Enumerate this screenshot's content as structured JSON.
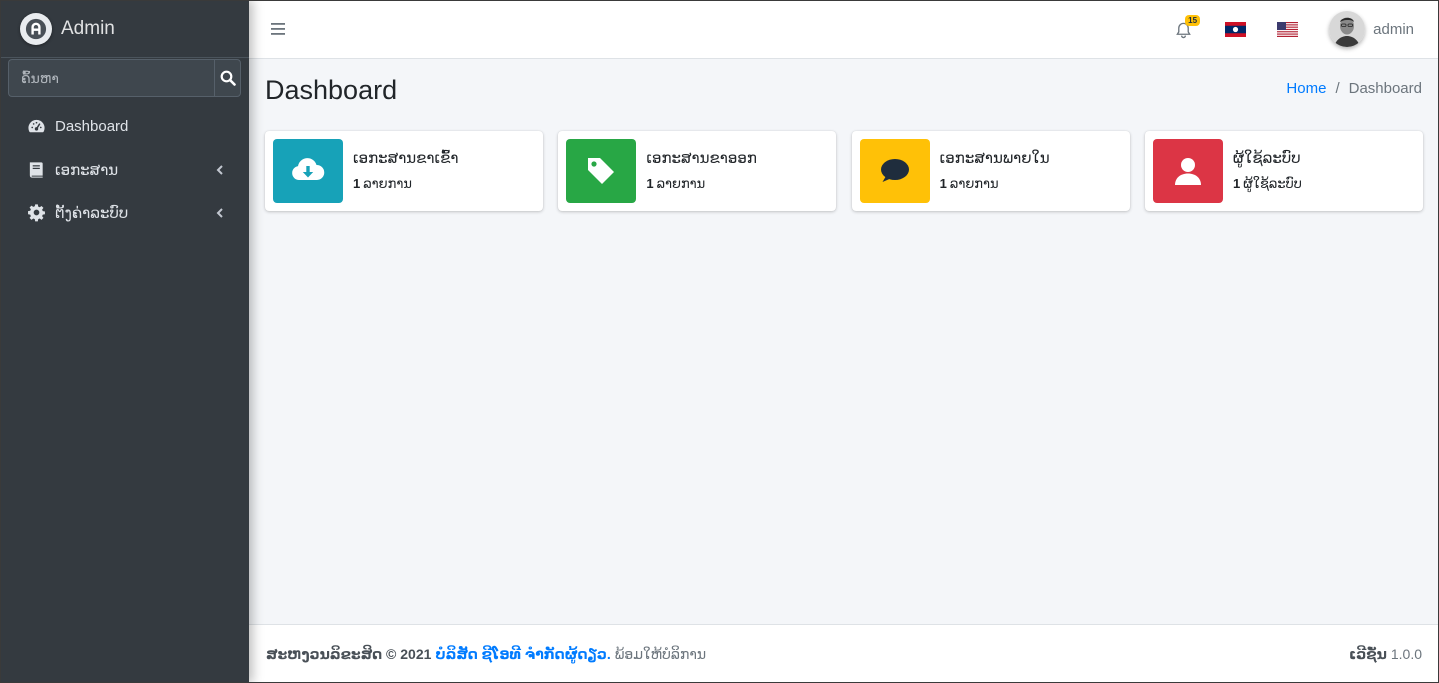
{
  "brand": {
    "name": "Admin"
  },
  "sidebar": {
    "search_placeholder": "ຄົ້ນຫາ",
    "items": [
      {
        "label": "Dashboard",
        "icon": "tachometer-icon",
        "has_children": false
      },
      {
        "label": "ເອກະສານ",
        "icon": "book-icon",
        "has_children": true
      },
      {
        "label": "ຕັ້ງຄ່າລະບົບ",
        "icon": "gear-icon",
        "has_children": true
      }
    ]
  },
  "topbar": {
    "notification_count": "15",
    "user_name": "admin"
  },
  "page": {
    "title": "Dashboard",
    "breadcrumb": {
      "home": "Home",
      "current": "Dashboard"
    }
  },
  "cards": [
    {
      "title": "ເອກະສານຂາເຂົ້າ",
      "count": "1",
      "unit": "ລາຍການ",
      "color": "#17a2b8",
      "icon": "cloud-download-icon"
    },
    {
      "title": "ເອກະສານຂາອອກ",
      "count": "1",
      "unit": "ລາຍການ",
      "color": "#28a745",
      "icon": "tag-icon"
    },
    {
      "title": "ເອກະສານພາຍໃນ",
      "count": "1",
      "unit": "ລາຍການ",
      "color": "#ffc107",
      "icon": "comment-icon"
    },
    {
      "title": "ຜູ້ໃຊ້ລະບົບ",
      "count": "1",
      "unit": "ຜູ້ໃຊ້ລະບົບ",
      "color": "#dc3545",
      "icon": "user-icon"
    }
  ],
  "footer": {
    "copyright_label": "ສະຫງວນລິຂະສິດ © 2021",
    "company": "ບໍລິສັດ ຊີໂອທີ ຈໍາກັດຜູ້ດຽວ.",
    "tagline": "ພ້ອມໃຫ້ບໍລິການ",
    "version_label": "ເວີຊັ່ນ",
    "version": "1.0.0"
  }
}
